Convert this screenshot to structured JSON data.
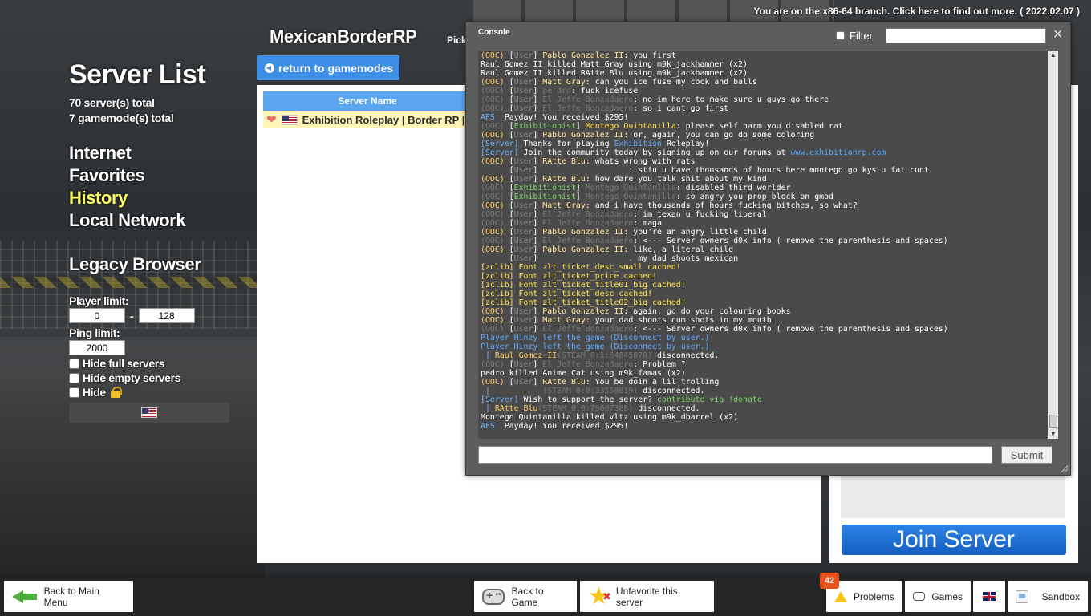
{
  "branch_notice": "You are on the x86-64 branch. Click here to find out more. ( 2022.02.07 )",
  "left": {
    "title": "Server List",
    "servers_total": "70 server(s) total",
    "gamemodes_total": "7 gamemode(s) total",
    "nav": [
      "Internet",
      "Favorites",
      "History",
      "Local Network"
    ],
    "active_nav": "History",
    "legacy": "Legacy Browser",
    "player_limit_label": "Player limit:",
    "player_min": "0",
    "player_max": "128",
    "dash": "-",
    "ping_limit_label": "Ping limit:",
    "ping_limit": "2000",
    "hide_full": "Hide full servers",
    "hide_empty": "Hide empty servers",
    "hide_locked": "Hide"
  },
  "gamemode": {
    "title": "MexicanBorderRP",
    "pick": "Pick",
    "return_label": "return to gamemodes"
  },
  "server_list": {
    "column_header": "Server Name",
    "rows": [
      {
        "name": "Exhibition Roleplay | Border RP |"
      }
    ]
  },
  "info_panel": {
    "join_label": "Join Server"
  },
  "console": {
    "title": "Console",
    "filter_label": "Filter",
    "close": "✕",
    "submit_label": "Submit"
  },
  "bottom": {
    "back_main": "Back to Main Menu",
    "back_game": "Back to Game",
    "unfavorite": "Unfavorite this server",
    "problems": "Problems",
    "problems_count": "42",
    "games": "Games",
    "sandbox": "Sandbox"
  },
  "colors": {
    "accent": "#3d8fe6",
    "join": "#1560c2",
    "active_nav": "#ffff66",
    "highlight_row": "#fff6b8",
    "badge": "#e8531c"
  }
}
